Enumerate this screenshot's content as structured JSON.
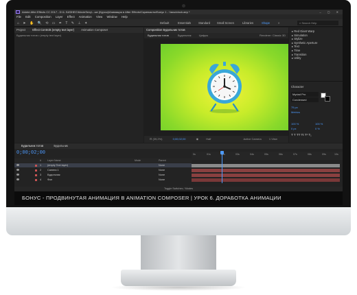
{
  "window": {
    "title": "Adobe After Effects CC 2017 - D:\\1. БИЗНЕС\\MovieSexy\\...ые (Курсы)\\Анимация в After Effects\\Cкринкасты\\Бонус 1 - Часы\\clock.aep *",
    "controls": "– ▢ ✕"
  },
  "menu": [
    "File",
    "Edit",
    "Composition",
    "Layer",
    "Effect",
    "Animation",
    "View",
    "Window",
    "Help"
  ],
  "toolbar": {
    "tools": "⌂ ➤ ✋ 🔍 ⟲ ▭ ✒ T ✎ ⊥ ✦",
    "workspaces": [
      "Default",
      "Essentials",
      "Standard",
      "Small Screen",
      "Libraries",
      "Shape"
    ],
    "active_workspace": "Shape",
    "overflow": "»",
    "search_placeholder": "Search Help"
  },
  "project_panel": {
    "tabs": [
      "Project",
      "Effect Controls (empty text layer)",
      "Animation Composer"
    ],
    "subheader": "Будильник тотов • (empty text layer)"
  },
  "composition_panel": {
    "tab": "Composition Будильник тотов",
    "subtabs": [
      "Будильник тотов",
      "Будильник",
      "Цифры"
    ],
    "renderer": "Renderer: Classic 3D",
    "footer": {
      "zoom": "(39,2%)",
      "timecode": "0;00;02;00",
      "quality": "Half",
      "camera": "Active Camera",
      "views": "1 View"
    }
  },
  "right_panel": {
    "effects_list": [
      "▸ Red Giant Warp",
      "▸ Simulation",
      "▸ Stylize",
      "▸ Synthetic Aperture",
      "▸ Text",
      "▸ Time",
      "▸ Transition",
      "▸ Utility"
    ],
    "character": {
      "title": "Character",
      "font": "Myriad Pro",
      "style": "Condensed",
      "size": "75 px",
      "tracking": "Metrics",
      "scale_v": "100 %",
      "scale_h": "100 %",
      "baseline": "0 px",
      "tsume": "0 %",
      "styles": "T T TT Tt T¹ T₁"
    }
  },
  "timeline": {
    "tabs": [
      "Будильник тотов",
      "Будильник"
    ],
    "timecode": "0;00;02;00",
    "columns": [
      "#",
      "Layer Name",
      "Mode",
      "Parent"
    ],
    "layers": [
      {
        "num": "1",
        "name": "(empty Text layer)",
        "mode": "None",
        "color": "#c65454",
        "selected": true
      },
      {
        "num": "2",
        "name": "Camera 1",
        "mode": "None",
        "color": "#c65454",
        "selected": false
      },
      {
        "num": "3",
        "name": "Будильник",
        "mode": "None",
        "color": "#c65454",
        "selected": false
      },
      {
        "num": "4",
        "name": "Фон",
        "mode": "None",
        "color": "#c65454",
        "selected": false
      }
    ],
    "ruler": [
      "0s",
      "01s",
      "02s",
      "03s",
      "04s",
      "05s",
      "06s",
      "07s",
      "08s",
      "09s",
      "10s"
    ],
    "footer": "Toggle Switches / Modes"
  },
  "subtitle": "БОНУС - ПРОДВИНУТАЯ АНИМАЦИЯ В ANIMATION COMPOSER | УРОК 6. ДОРАБОТКА АНИМАЦИИ",
  "colors": {
    "accent": "#4d9bff",
    "canvas_center": "#f2f23a",
    "canvas_edge": "#6fcf2c",
    "clock_blue": "#3aa7d8",
    "layer_bar": "#8a4040"
  }
}
